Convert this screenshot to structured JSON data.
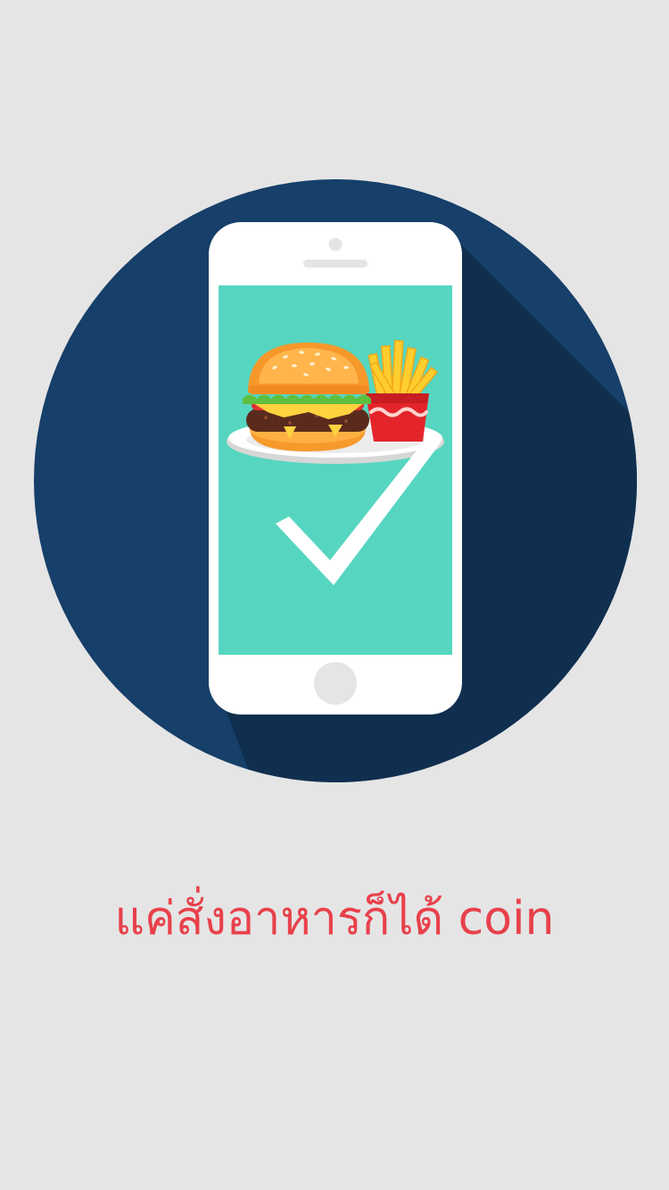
{
  "onboarding": {
    "caption": "แค่สั่งอาหารก็ได้ coin"
  },
  "illustration": {
    "icons": [
      "phone-icon",
      "burger-icon",
      "fries-icon",
      "plate-icon",
      "checkmark-icon"
    ]
  },
  "colors": {
    "background": "#e5e5e5",
    "circle": "#163f69",
    "shadow": "#102f4f",
    "phone_body": "#ffffff",
    "screen": "#56d6c0",
    "caption": "#e8414b"
  }
}
